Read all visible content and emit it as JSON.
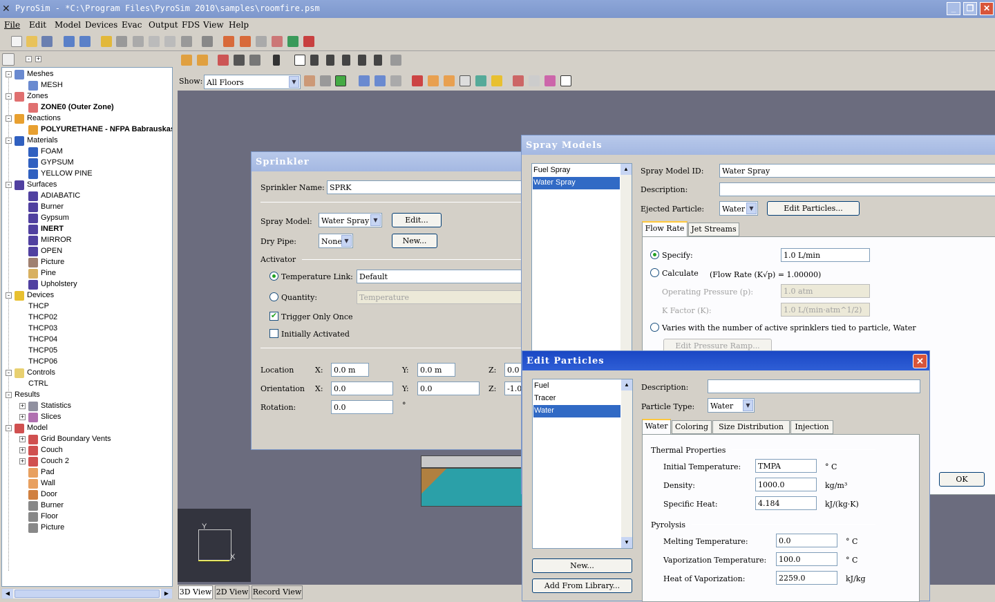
{
  "app": {
    "title": "PyroSim - *C:\\Program Files\\PyroSim 2010\\samples\\roomfire.psm"
  },
  "menu": [
    "File",
    "Edit",
    "Model",
    "Devices",
    "Evac",
    "Output",
    "FDS",
    "View",
    "Help"
  ],
  "show": {
    "label": "Show:",
    "value": "All Floors"
  },
  "tree": [
    {
      "text": "Meshes",
      "level": 0,
      "icon": "mesh-icon",
      "bold": false,
      "exp": "-"
    },
    {
      "text": "MESH",
      "level": 1,
      "icon": "mesh-icon",
      "bold": false
    },
    {
      "text": "Zones",
      "level": 0,
      "icon": "zone-icon",
      "bold": false,
      "exp": "-"
    },
    {
      "text": "ZONE0 (Outer Zone)",
      "level": 1,
      "icon": "zone-icon",
      "bold": true
    },
    {
      "text": "Reactions",
      "level": 0,
      "icon": "reaction-icon",
      "bold": false,
      "exp": "-"
    },
    {
      "text": "POLYURETHANE - NFPA Babrauskas",
      "level": 1,
      "icon": "reaction-icon",
      "bold": true
    },
    {
      "text": "Materials",
      "level": 0,
      "icon": "material-icon",
      "bold": false,
      "exp": "-"
    },
    {
      "text": "FOAM",
      "level": 1,
      "icon": "material-icon",
      "bold": false
    },
    {
      "text": "GYPSUM",
      "level": 1,
      "icon": "material-icon",
      "bold": false
    },
    {
      "text": "YELLOW PINE",
      "level": 1,
      "icon": "material-icon",
      "bold": false
    },
    {
      "text": "Surfaces",
      "level": 0,
      "icon": "surface-icon",
      "bold": false,
      "exp": "-"
    },
    {
      "text": "ADIABATIC",
      "level": 1,
      "icon": "surface-icon",
      "bold": false
    },
    {
      "text": "Burner",
      "level": 1,
      "icon": "surface-icon",
      "bold": false
    },
    {
      "text": "Gypsum",
      "level": 1,
      "icon": "surface-icon",
      "bold": false
    },
    {
      "text": "INERT",
      "level": 1,
      "icon": "surface-icon",
      "bold": true
    },
    {
      "text": "MIRROR",
      "level": 1,
      "icon": "surface-icon",
      "bold": false
    },
    {
      "text": "OPEN",
      "level": 1,
      "icon": "surface-icon",
      "bold": false
    },
    {
      "text": "Picture",
      "level": 1,
      "icon": "picture-icon",
      "bold": false
    },
    {
      "text": "Pine",
      "level": 1,
      "icon": "pine-icon",
      "bold": false
    },
    {
      "text": "Upholstery",
      "level": 1,
      "icon": "surface-icon",
      "bold": false
    },
    {
      "text": "Devices",
      "level": 0,
      "icon": "device-icon",
      "bold": false,
      "exp": "-"
    },
    {
      "text": "THCP",
      "level": 1,
      "icon": "",
      "bold": false
    },
    {
      "text": "THCP02",
      "level": 1,
      "icon": "",
      "bold": false
    },
    {
      "text": "THCP03",
      "level": 1,
      "icon": "",
      "bold": false
    },
    {
      "text": "THCP04",
      "level": 1,
      "icon": "",
      "bold": false
    },
    {
      "text": "THCP05",
      "level": 1,
      "icon": "",
      "bold": false
    },
    {
      "text": "THCP06",
      "level": 1,
      "icon": "",
      "bold": false
    },
    {
      "text": "Controls",
      "level": 0,
      "icon": "control-icon",
      "bold": false,
      "exp": "-"
    },
    {
      "text": "CTRL",
      "level": 1,
      "icon": "",
      "bold": false
    },
    {
      "text": "Results",
      "level": 0,
      "icon": "",
      "bold": false,
      "exp": "-"
    },
    {
      "text": "Statistics",
      "level": 1,
      "icon": "statistics-icon",
      "bold": false,
      "exp": "+"
    },
    {
      "text": "Slices",
      "level": 1,
      "icon": "slice-icon",
      "bold": false,
      "exp": "+"
    },
    {
      "text": "Model",
      "level": 0,
      "icon": "model-icon",
      "bold": false,
      "exp": "-"
    },
    {
      "text": "Grid Boundary Vents",
      "level": 1,
      "icon": "model-icon",
      "bold": false,
      "exp": "+"
    },
    {
      "text": "Couch",
      "level": 1,
      "icon": "model-icon",
      "bold": false,
      "exp": "+"
    },
    {
      "text": "Couch 2",
      "level": 1,
      "icon": "model-icon",
      "bold": false,
      "exp": "+"
    },
    {
      "text": "Pad",
      "level": 1,
      "icon": "obstruction-icon",
      "bold": false
    },
    {
      "text": "Wall",
      "level": 1,
      "icon": "obstruction-icon",
      "bold": false
    },
    {
      "text": "Door",
      "level": 1,
      "icon": "door-icon",
      "bold": false
    },
    {
      "text": "Burner",
      "level": 1,
      "icon": "burner-icon",
      "bold": false
    },
    {
      "text": "Floor",
      "level": 1,
      "icon": "burner-icon",
      "bold": false
    },
    {
      "text": "Picture",
      "level": 1,
      "icon": "burner-icon",
      "bold": false
    }
  ],
  "bottom_tabs": [
    "3D View",
    "2D View",
    "Record View"
  ],
  "sprinkler": {
    "title": "Sprinkler",
    "name_label": "Sprinkler Name:",
    "name_value": "SPRK",
    "spray_label": "Spray Model:",
    "spray_value": "Water Spray",
    "edit_btn": "Edit...",
    "new_btn": "New...",
    "dry_label": "Dry Pipe:",
    "dry_value": "None",
    "activator_label": "Activator",
    "temp_link_label": "Temperature Link:",
    "temp_link_value": "Default",
    "quantity_label": "Quantity:",
    "quantity_value": "Temperature",
    "trigger_label": "Trigger Only Once",
    "init_label": "Initially Activated",
    "location_label": "Location",
    "orientation_label": "Orientation",
    "rotation_label": "Rotation:",
    "x_label": "X:",
    "y_label": "Y:",
    "z_label": "Z:",
    "loc_x": "0.0 m",
    "loc_y": "0.0 m",
    "loc_z": "0.0",
    "ori_x": "0.0",
    "ori_y": "0.0",
    "ori_z": "-1.0",
    "rot": "0.0",
    "deg": "°"
  },
  "spray": {
    "title": "Spray Models",
    "list": [
      "Fuel Spray",
      "Water Spray"
    ],
    "id_label": "Spray Model ID:",
    "id_value": "Water Spray",
    "desc_label": "Description:",
    "ejected_label": "Ejected Particle:",
    "ejected_value": "Water",
    "edit_particles": "Edit Particles...",
    "tab_flow": "Flow Rate",
    "tab_jet": "Jet Streams",
    "specify_label": "Specify:",
    "specify_value": "1.0 L/min",
    "calculate_label": "Calculate",
    "calc_formula": "(Flow Rate (K√p) = 1.00000)",
    "pressure_label": "Operating Pressure (p):",
    "pressure_value": "1.0 atm",
    "kfactor_label": "K Factor (K):",
    "kfactor_value": "1.0 L/(min·atm^1/2)",
    "varies_label": "Varies with the number of active sprinklers tied to particle, Water",
    "ramp_btn": "Edit Pressure Ramp...",
    "ok_btn": "OK"
  },
  "particles": {
    "title": "Edit Particles",
    "list": [
      "Fuel",
      "Tracer",
      "Water"
    ],
    "desc_label": "Description:",
    "type_label": "Particle Type:",
    "type_value": "Water",
    "tabs": [
      "Water",
      "Coloring",
      "Size Distribution",
      "Injection"
    ],
    "thermal_label": "Thermal Properties",
    "init_temp_label": "Initial Temperature:",
    "init_temp_value": "TMPA",
    "init_temp_unit": "° C",
    "density_label": "Density:",
    "density_value": "1000.0",
    "density_unit": "kg/m³",
    "heat_label": "Specific Heat:",
    "heat_value": "4.184",
    "heat_unit": "kJ/(kg·K)",
    "pyrolysis_label": "Pyrolysis",
    "melt_label": "Melting Temperature:",
    "melt_value": "0.0",
    "melt_unit": "° C",
    "vap_label": "Vaporization Temperature:",
    "vap_value": "100.0",
    "vap_unit": "° C",
    "hov_label": "Heat of Vaporization:",
    "hov_value": "2259.0",
    "hov_unit": "kJ/kg",
    "new_btn": "New...",
    "lib_btn": "Add From Library...",
    "close": "✕"
  },
  "axis": {
    "x": "X",
    "y": "Y"
  }
}
